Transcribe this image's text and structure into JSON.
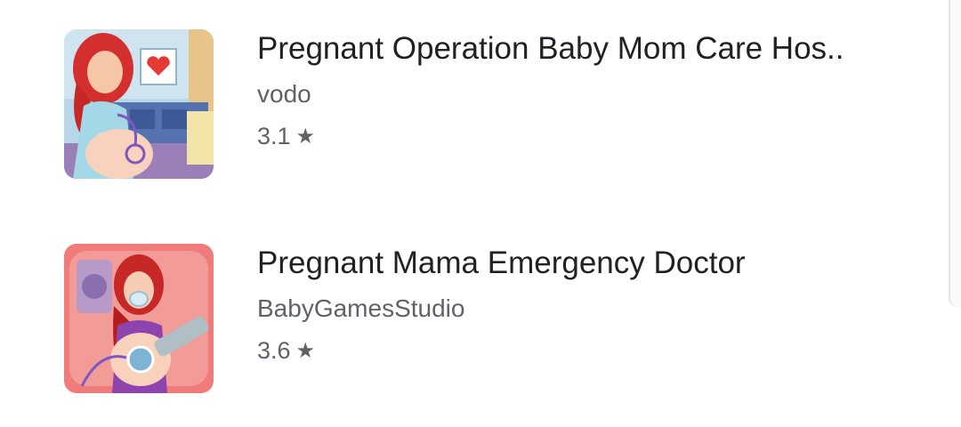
{
  "apps": [
    {
      "title": "Pregnant Operation Baby Mom Care Hos..",
      "developer": "vodo",
      "rating": "3.1",
      "rating_icon": "star-icon",
      "icon": "app-icon-pregnant-operation"
    },
    {
      "title": "Pregnant Mama Emergency Doctor",
      "developer": "BabyGamesStudio",
      "rating": "3.6",
      "rating_icon": "star-icon",
      "icon": "app-icon-pregnant-mama"
    }
  ],
  "colors": {
    "title": "#202124",
    "secondary": "#5f6368"
  }
}
